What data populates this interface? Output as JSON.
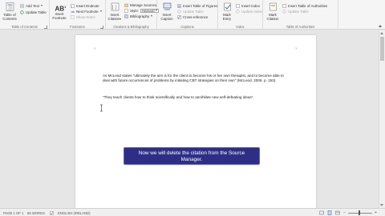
{
  "ribbon": {
    "toc": {
      "button_label": "Table of Contents",
      "add_text": "Add Text",
      "update_table": "Update Table",
      "group_label": "Table of Contents"
    },
    "footnotes": {
      "insert_footnote": "Insert Footnote",
      "insert_endnote": "Insert Endnote",
      "next_footnote": "Next Footnote",
      "show_notes": "Show Notes",
      "group_label": "Footnotes"
    },
    "citations": {
      "insert_citation": "Insert Citation",
      "manage_sources": "Manage Sources",
      "style_label": "Style:",
      "style_value": "Harvard",
      "bibliography": "Bibliography",
      "group_label": "Citations & Bibliography"
    },
    "captions": {
      "insert_caption": "Insert Caption",
      "insert_table_of_figures": "Insert Table of Figures",
      "update_table": "Update Table",
      "cross_reference": "Cross-reference",
      "group_label": "Captions"
    },
    "index": {
      "mark_entry": "Mark Entry",
      "insert_index": "Insert Index",
      "update_index": "Update Index",
      "group_label": "Index"
    },
    "toa": {
      "mark_citation": "Mark Citation",
      "insert_table_of_authorities": "Insert Table of Authorities",
      "update_table": "Update Table",
      "group_label": "Table of Authorities"
    }
  },
  "document": {
    "paragraph1": "As McLeod states \"ultimately the aim is for the client to become his or her own therapist, and to become able to deal with future occurrences of problems by initiating CBT strategies on their own\" (McLeod, 2009, p. 153).",
    "paragraph2": "\"They teach clients how to think scientifically and how to annihilate new self-defeating ideas\"."
  },
  "callout": {
    "text": "Now we will delete the citation from the Source Manager."
  },
  "status_bar": {
    "page": "PAGE 1 OF 1",
    "words": "55 WORDS",
    "language": "ENGLISH (IRELAND)"
  }
}
